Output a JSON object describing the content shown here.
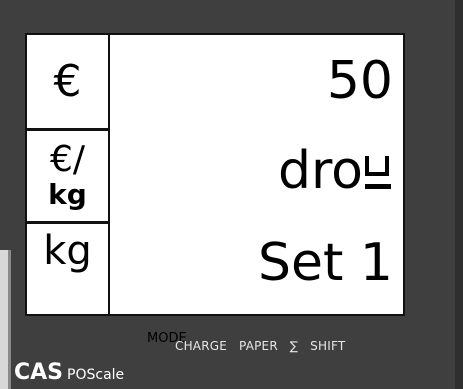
{
  "units": {
    "currency": "€",
    "per_kg_top": "€/",
    "per_kg_bottom": "kg",
    "weight": "kg"
  },
  "display": {
    "row1_value": "50",
    "row2_value": "dro",
    "row3_value": "Set 1",
    "mode_label": "MODE"
  },
  "keys": {
    "charge": "CHARGE",
    "paper": "PAPER",
    "sum": "∑",
    "shift": "SHIFT"
  },
  "brand": {
    "name": "CAS",
    "model": "POScale"
  },
  "colors": {
    "housing": "#3f3f3f",
    "lcd_background": "#ffffff",
    "lcd_text": "#000000"
  }
}
